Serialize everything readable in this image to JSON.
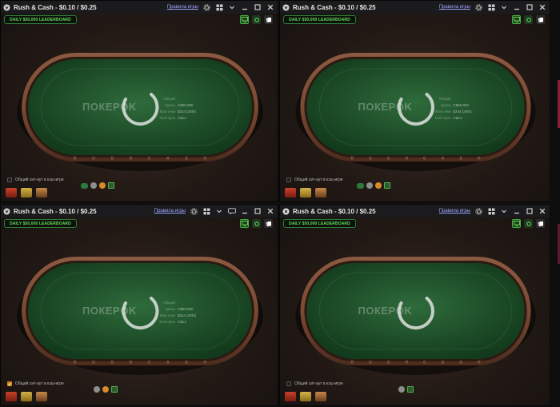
{
  "windows": [
    {
      "title": "Rush & Cash - $0.10 / $0.25",
      "rules_link": "Правила игры",
      "show_rules_link": true,
      "leaderboard": "DAILY $50,000 LEADERBOARD",
      "logo": "ПОКЕРOK",
      "info": [
        {
          "key": "Общий призы",
          "value": "C$50,000"
        },
        {
          "key": "Мои очки",
          "value": "$244 (30th)"
        },
        {
          "key": "Мой приз",
          "value": "C$14"
        }
      ],
      "checkbox_label": "Общий сит-аут в кэш-игре",
      "checkbox_checked": false,
      "action_icons": [
        "chat-icon",
        "cloud-icon",
        "gift-icon",
        "stats-icon"
      ]
    },
    {
      "title": "Rush & Cash - $0.10 / $0.25",
      "rules_link": "Правила игры",
      "show_rules_link": true,
      "leaderboard": "DAILY $50,000 LEADERBOARD",
      "logo": "ПОКЕРOK",
      "info": [
        {
          "key": "Общий призы",
          "value": "C$50,000"
        },
        {
          "key": "Мои очки",
          "value": "$244 (30th)"
        },
        {
          "key": "Мой приз",
          "value": "C$14"
        }
      ],
      "checkbox_label": "Общий сит-аут в кэш-игре",
      "checkbox_checked": false,
      "action_icons": [
        "chat-icon",
        "cloud-icon",
        "gift-icon",
        "stats-icon"
      ]
    },
    {
      "title": "Rush & Cash - $0.10 / $0.25",
      "rules_link": "Правила игры",
      "show_rules_link": true,
      "leaderboard": "DAILY $50,000 LEADERBOARD",
      "logo": "ПОКЕРOK",
      "info": [
        {
          "key": "Общий призы",
          "value": "C$50,000"
        },
        {
          "key": "Мои очки",
          "value": "$244 (30th)"
        },
        {
          "key": "Мой приз",
          "value": "C$14"
        }
      ],
      "checkbox_label": "Общий сит-аут в кэш-игре",
      "checkbox_checked": true,
      "action_icons": [
        "cloud-icon",
        "gift-icon",
        "stats-icon"
      ]
    },
    {
      "title": "Rush & Cash - $0.10 / $0.25",
      "rules_link": "Правила игры",
      "show_rules_link": true,
      "leaderboard": "DAILY $50,000 LEADERBOARD",
      "logo": "ПОКЕРOK",
      "info": [],
      "checkbox_label": "Общий сит-аут в кэш-игре",
      "checkbox_checked": false,
      "action_icons": [
        "cloud-icon",
        "stats-icon"
      ]
    }
  ],
  "rail_text": "RUSH CASH",
  "colors": {
    "felt_center": "#2f6b3b",
    "felt_edge": "#123a1c",
    "rail": "#7a4a34",
    "leaderboard_text": "#68d95a",
    "link": "#9ea4ff",
    "accent_green": "#3fae3f"
  }
}
